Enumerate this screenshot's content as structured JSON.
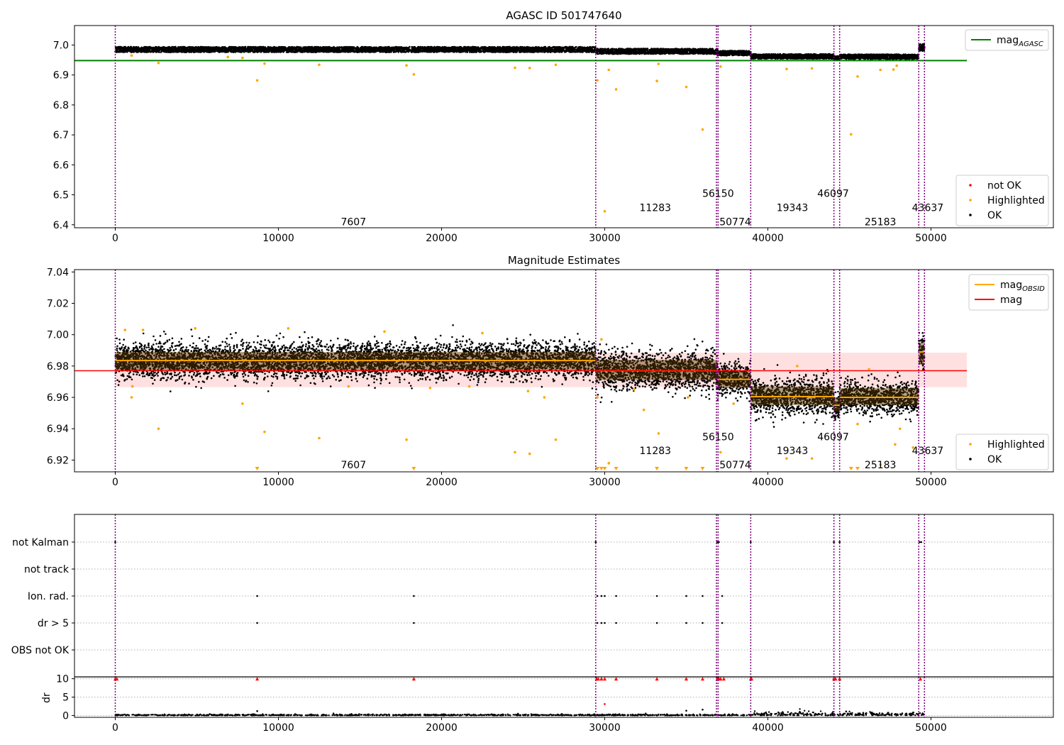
{
  "chart_data": [
    {
      "type": "scatter",
      "title": "AGASC ID 501747640",
      "xlim": [
        -2500,
        57500
      ],
      "ylim": [
        6.39,
        7.065
      ],
      "x_ticks": [
        0,
        10000,
        20000,
        30000,
        40000,
        50000
      ],
      "y_ticks": [
        6.4,
        6.5,
        6.6,
        6.7,
        6.8,
        6.9,
        7.0
      ],
      "y_tick_labels": [
        "6.4",
        "6.5",
        "6.6",
        "6.7",
        "6.8",
        "6.9",
        "7.0"
      ],
      "reference_line": {
        "name": "mag",
        "sub": "AGASC",
        "value": 6.948,
        "x_range": [
          -2500,
          52200
        ],
        "color": "#008000"
      },
      "obs_bands": [
        {
          "x_start": 0,
          "x_end": 29450,
          "center": 6.985,
          "half_width": 0.009
        },
        {
          "x_start": 29450,
          "x_end": 36900,
          "center": 6.979,
          "half_width": 0.009
        },
        {
          "x_start": 36900,
          "x_end": 38950,
          "center": 6.973,
          "half_width": 0.008
        },
        {
          "x_start": 38950,
          "x_end": 44050,
          "center": 6.962,
          "half_width": 0.008
        },
        {
          "x_start": 44050,
          "x_end": 44400,
          "center": 6.957,
          "half_width": 0.006
        },
        {
          "x_start": 44400,
          "x_end": 49250,
          "center": 6.961,
          "half_width": 0.008
        },
        {
          "x_start": 49250,
          "x_end": 49600,
          "center": 6.992,
          "half_width": 0.012
        }
      ],
      "highlighted_points": [
        [
          8700,
          6.882
        ],
        [
          9150,
          6.938
        ],
        [
          12500,
          6.934
        ],
        [
          17850,
          6.932
        ],
        [
          18300,
          6.902
        ],
        [
          2650,
          6.94
        ],
        [
          24500,
          6.924
        ],
        [
          25400,
          6.923
        ],
        [
          27000,
          6.934
        ],
        [
          29550,
          6.882
        ],
        [
          30000,
          6.445
        ],
        [
          30250,
          6.917
        ],
        [
          30700,
          6.852
        ],
        [
          33200,
          6.88
        ],
        [
          33300,
          6.937
        ],
        [
          35000,
          6.86
        ],
        [
          36000,
          6.718
        ],
        [
          37100,
          6.928
        ],
        [
          41150,
          6.92
        ],
        [
          42700,
          6.922
        ],
        [
          45100,
          6.702
        ],
        [
          45500,
          6.895
        ],
        [
          46900,
          6.917
        ],
        [
          47700,
          6.918
        ],
        [
          47900,
          6.931
        ],
        [
          1000,
          6.965
        ],
        [
          6900,
          6.96
        ],
        [
          7800,
          6.957
        ]
      ],
      "obs_labels": [
        {
          "text": "7607",
          "x": 14600,
          "y": 6.41
        },
        {
          "text": "11283",
          "x": 33100,
          "y": 6.457
        },
        {
          "text": "56150",
          "x": 36950,
          "y": 6.505
        },
        {
          "text": "50774",
          "x": 38000,
          "y": 6.41
        },
        {
          "text": "19343",
          "x": 41500,
          "y": 6.457
        },
        {
          "text": "46097",
          "x": 44000,
          "y": 6.505
        },
        {
          "text": "25183",
          "x": 46900,
          "y": 6.41
        },
        {
          "text": "43637",
          "x": 49800,
          "y": 6.457
        }
      ],
      "legend_top": {
        "placement": "upper right",
        "entries": [
          {
            "label": "mag",
            "sub": "AGASC",
            "color": "#008000"
          }
        ]
      },
      "legend_bottom": {
        "placement": "lower right",
        "entries": [
          {
            "label": "not OK",
            "color": "#ff0000"
          },
          {
            "label": "Highlighted",
            "color": "#ffa500"
          },
          {
            "label": "OK",
            "color": "#000000"
          }
        ]
      }
    },
    {
      "type": "scatter",
      "title": "Magnitude Estimates",
      "xlim": [
        -2500,
        57500
      ],
      "ylim": [
        6.9125,
        7.0415
      ],
      "x_ticks": [
        0,
        10000,
        20000,
        30000,
        40000,
        50000
      ],
      "y_ticks": [
        6.92,
        6.94,
        6.96,
        6.98,
        7.0,
        7.02,
        7.04
      ],
      "y_tick_labels": [
        "6.92",
        "6.94",
        "6.96",
        "6.98",
        "7.00",
        "7.02",
        "7.04"
      ],
      "mean_line": {
        "name": "mag",
        "value": 6.977,
        "band": [
          6.9665,
          6.9885
        ],
        "x_range": [
          -2500,
          52200
        ],
        "color": "#ff0000"
      },
      "obsid_means": [
        {
          "x_start": 0,
          "x_end": 29450,
          "value": 6.9835,
          "spread": [
            6.977,
            6.989
          ]
        },
        {
          "x_start": 29450,
          "x_end": 36900,
          "value": 6.977,
          "spread": [
            6.971,
            6.984
          ]
        },
        {
          "x_start": 36900,
          "x_end": 38950,
          "value": 6.9715,
          "spread": [
            6.966,
            6.977
          ]
        },
        {
          "x_start": 38950,
          "x_end": 44050,
          "value": 6.9605,
          "spread": [
            6.955,
            6.967
          ]
        },
        {
          "x_start": 44050,
          "x_end": 44400,
          "value": 6.955,
          "spread": [
            6.951,
            6.96
          ]
        },
        {
          "x_start": 44400,
          "x_end": 49250,
          "value": 6.96,
          "spread": [
            6.955,
            6.966
          ]
        },
        {
          "x_start": 49250,
          "x_end": 49600,
          "value": 6.989,
          "spread": [
            6.981,
            6.995
          ]
        }
      ],
      "highlighted_points": [
        [
          1000,
          6.96
        ],
        [
          1050,
          6.967
        ],
        [
          2650,
          6.94
        ],
        [
          7800,
          6.956
        ],
        [
          9150,
          6.938
        ],
        [
          12500,
          6.934
        ],
        [
          14300,
          6.967
        ],
        [
          17850,
          6.933
        ],
        [
          19300,
          6.966
        ],
        [
          21700,
          6.967
        ],
        [
          24500,
          6.925
        ],
        [
          25400,
          6.924
        ],
        [
          25300,
          6.964
        ],
        [
          26300,
          6.96
        ],
        [
          27000,
          6.933
        ],
        [
          29550,
          6.96
        ],
        [
          30250,
          6.918
        ],
        [
          31800,
          6.965
        ],
        [
          32400,
          6.952
        ],
        [
          33300,
          6.937
        ],
        [
          35100,
          6.96
        ],
        [
          37100,
          6.925
        ],
        [
          37900,
          6.956
        ],
        [
          41150,
          6.921
        ],
        [
          42700,
          6.921
        ],
        [
          45500,
          6.943
        ],
        [
          46900,
          6.917
        ],
        [
          47800,
          6.93
        ],
        [
          48100,
          6.94
        ],
        [
          48900,
          6.928
        ],
        [
          41800,
          6.98
        ],
        [
          46200,
          6.978
        ],
        [
          600,
          7.003
        ],
        [
          4900,
          7.004
        ],
        [
          10600,
          7.004
        ],
        [
          1700,
          7.003
        ],
        [
          16500,
          7.002
        ],
        [
          22500,
          7.001
        ],
        [
          29800,
          6.997
        ]
      ],
      "clipped_points_x": [
        8700,
        18300,
        29550,
        29800,
        30000,
        30700,
        33200,
        35000,
        36000,
        45100,
        45500
      ],
      "obs_labels": [
        {
          "text": "7607",
          "x": 14600,
          "y": 6.917
        },
        {
          "text": "11283",
          "x": 33100,
          "y": 6.926
        },
        {
          "text": "56150",
          "x": 36950,
          "y": 6.935
        },
        {
          "text": "50774",
          "x": 38000,
          "y": 6.917
        },
        {
          "text": "19343",
          "x": 41500,
          "y": 6.926
        },
        {
          "text": "46097",
          "x": 44000,
          "y": 6.935
        },
        {
          "text": "25183",
          "x": 46900,
          "y": 6.917
        },
        {
          "text": "43637",
          "x": 49800,
          "y": 6.926
        }
      ],
      "legend_top": {
        "placement": "upper right",
        "entries": [
          {
            "label": "mag",
            "sub": "OBSID",
            "color": "#ffa500"
          },
          {
            "label": "mag",
            "sub": "",
            "color": "#ff0000"
          }
        ]
      },
      "legend_bottom": {
        "placement": "lower right",
        "entries": [
          {
            "label": "Highlighted",
            "color": "#ffa500"
          },
          {
            "label": "OK",
            "color": "#000000"
          }
        ]
      }
    },
    {
      "type": "scatter",
      "title": "",
      "xlim": [
        -2500,
        57500
      ],
      "x_ticks": [
        0,
        10000,
        20000,
        30000,
        40000,
        50000
      ],
      "flag_rows": [
        "not Kalman",
        "not track",
        "Ion. rad.",
        "dr > 5",
        "OBS not OK"
      ],
      "flag_points": {
        "not Kalman": [
          0,
          29450,
          36900,
          37000,
          38950,
          44050,
          44400,
          49300,
          49400
        ],
        "not track": [],
        "Ion. rad.": [
          8700,
          18300,
          29550,
          29800,
          30000,
          30700,
          33200,
          35000,
          36000,
          37200
        ],
        "dr > 5": [
          8700,
          18300,
          29550,
          29800,
          30000,
          30700,
          33200,
          35000,
          36000,
          37200
        ],
        "OBS not OK": []
      },
      "dr_axis": {
        "label": "dr",
        "ylim": [
          -0.5,
          10.5
        ],
        "ticks": [
          0,
          5,
          10
        ],
        "tick_labels": [
          "0",
          "5",
          "10"
        ]
      },
      "dr_clipped_x": [
        0,
        100,
        8700,
        18300,
        29500,
        29600,
        29800,
        30000,
        30700,
        33200,
        35000,
        36000,
        36900,
        36950,
        37000,
        37100,
        37300,
        38950,
        39000,
        44050,
        44150,
        44400,
        49350
      ],
      "dr_outliers": [
        [
          30000,
          3.1
        ],
        [
          8700,
          1.2
        ],
        [
          35000,
          1.3
        ],
        [
          36000,
          1.6
        ],
        [
          44800,
          1.1
        ]
      ],
      "colors": {
        "vlines": "#800080",
        "ok": "#000000",
        "highlighted": "#ffa500",
        "not_ok": "#ff0000",
        "band": "#ff0000"
      }
    }
  ],
  "obs_boundaries": [
    0,
    29450,
    36850,
    36950,
    38950,
    44050,
    44400,
    49250,
    49600
  ]
}
